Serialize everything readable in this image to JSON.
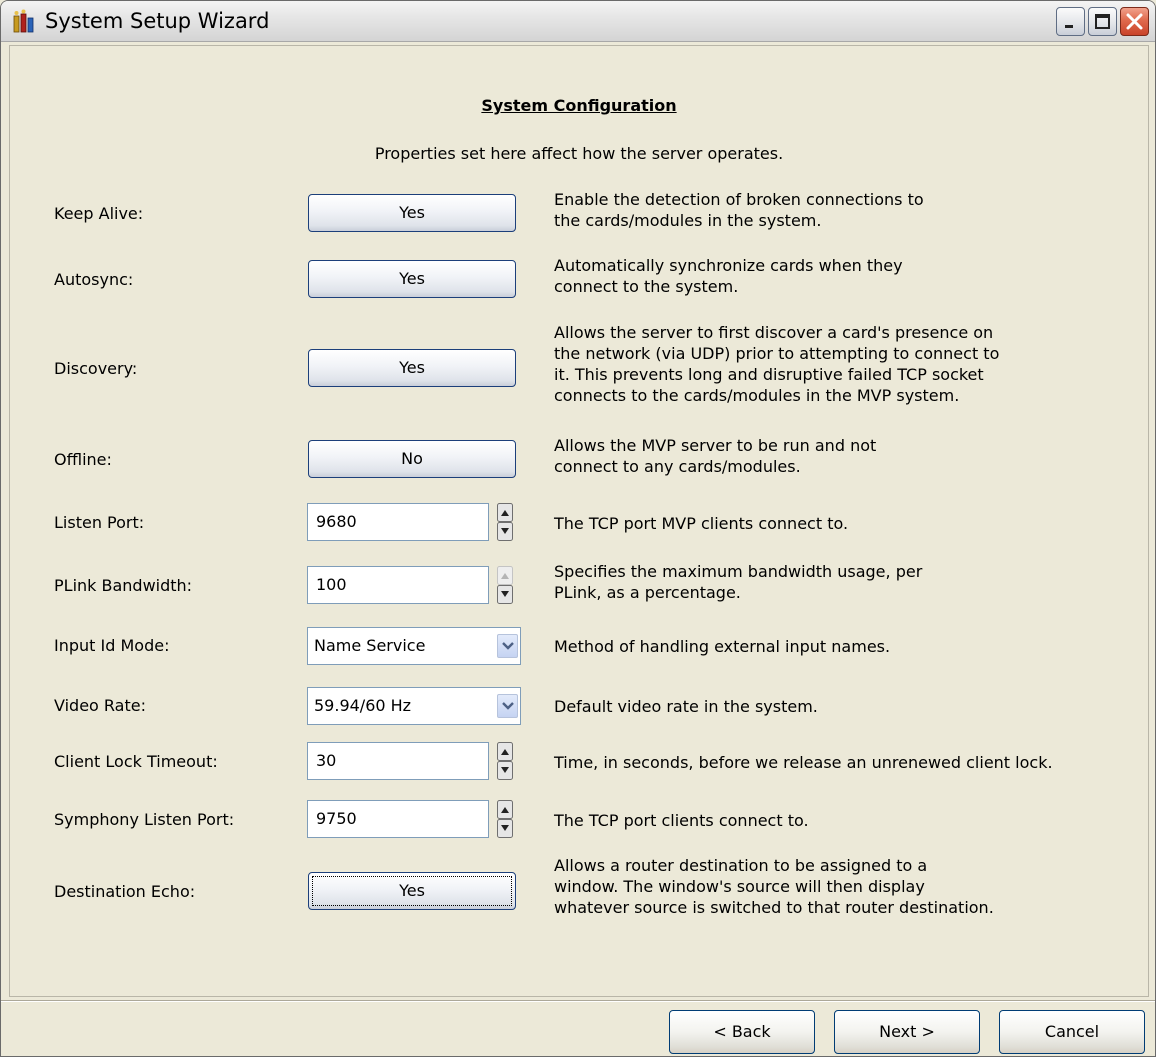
{
  "window": {
    "title": "System Setup Wizard"
  },
  "panel": {
    "heading": "System Configuration",
    "subheading": "Properties set here affect how the server operates."
  },
  "settings": {
    "keep_alive": {
      "label": "Keep Alive:",
      "value": "Yes",
      "desc": [
        "Enable the detection of broken connections to",
        "the cards/modules in the system."
      ]
    },
    "autosync": {
      "label": "Autosync:",
      "value": "Yes",
      "desc": [
        "Automatically synchronize cards when they",
        "connect to the system."
      ]
    },
    "discovery": {
      "label": "Discovery:",
      "value": "Yes",
      "desc": [
        "Allows the server to first discover a card's presence on",
        "the network (via UDP) prior to attempting to connect to",
        "it.  This prevents long and disruptive failed TCP socket",
        "connects to the cards/modules in the MVP system."
      ]
    },
    "offline": {
      "label": "Offline:",
      "value": "No",
      "desc": [
        "Allows the MVP server to be run and not",
        "connect to any cards/modules."
      ]
    },
    "listen_port": {
      "label": "Listen Port:",
      "value": "9680",
      "desc": [
        "The TCP port MVP clients connect to."
      ]
    },
    "plink_bandwidth": {
      "label": "PLink Bandwidth:",
      "value": "100",
      "desc": [
        "Specifies the maximum bandwidth usage, per",
        "PLink, as a percentage."
      ]
    },
    "input_id_mode": {
      "label": "Input Id Mode:",
      "value": "Name Service",
      "desc": [
        "Method of handling external input names."
      ]
    },
    "video_rate": {
      "label": "Video Rate:",
      "value": "59.94/60 Hz",
      "desc": [
        "Default video rate in the system."
      ]
    },
    "client_lock_timeout": {
      "label": "Client Lock Timeout:",
      "value": "30",
      "desc": [
        "Time, in seconds, before we release an unrenewed client lock."
      ]
    },
    "symphony_listen_port": {
      "label": "Symphony Listen Port:",
      "value": "9750",
      "desc": [
        "The TCP port clients connect to."
      ]
    },
    "destination_echo": {
      "label": "Destination Echo:",
      "value": "Yes",
      "desc": [
        "Allows a router destination to be assigned to a",
        "window.  The window's source will then display",
        "whatever source is switched to that router destination."
      ]
    }
  },
  "footer": {
    "back": "< Back",
    "next": "Next >",
    "cancel": "Cancel"
  },
  "icons": {
    "title": "app-icon",
    "minimize": "minimize-icon",
    "maximize": "maximize-icon",
    "close": "close-icon"
  },
  "colors": {
    "window_bg": "#ece9d8",
    "close_button": "#e06a4d",
    "button_border": "#1c3f7a"
  }
}
